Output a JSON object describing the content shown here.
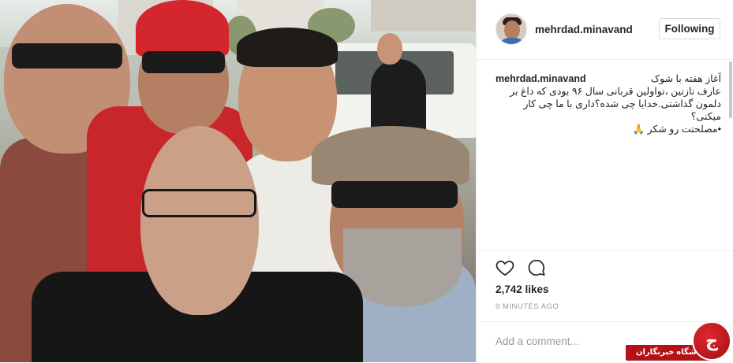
{
  "post": {
    "username": "mehrdad.minavand",
    "follow_label": "Following",
    "caption": {
      "username": "mehrdad.minavand",
      "text": "آغاز هفته با شوک\nعارف نازنین ،تواولین قربانی سال ۹۶ بودی که داغ بر\nدلمون گذاشتی.خدایا چی شده؟داری با ما چی کار میکنی؟\n•مصلحتت رو شکر 🙏"
    },
    "likes": "2,742 likes",
    "time_ago": "9 MINUTES AGO",
    "comment_placeholder": "Add a comment..."
  },
  "icons": {
    "like": "heart-icon",
    "comment": "comment-icon"
  },
  "watermark": {
    "label": "باشگاه خبرنگاران",
    "mark": "ج",
    "color": "#b41217"
  },
  "colors": {
    "text": "#262626",
    "muted": "#999999",
    "border": "#dbdbdb"
  }
}
